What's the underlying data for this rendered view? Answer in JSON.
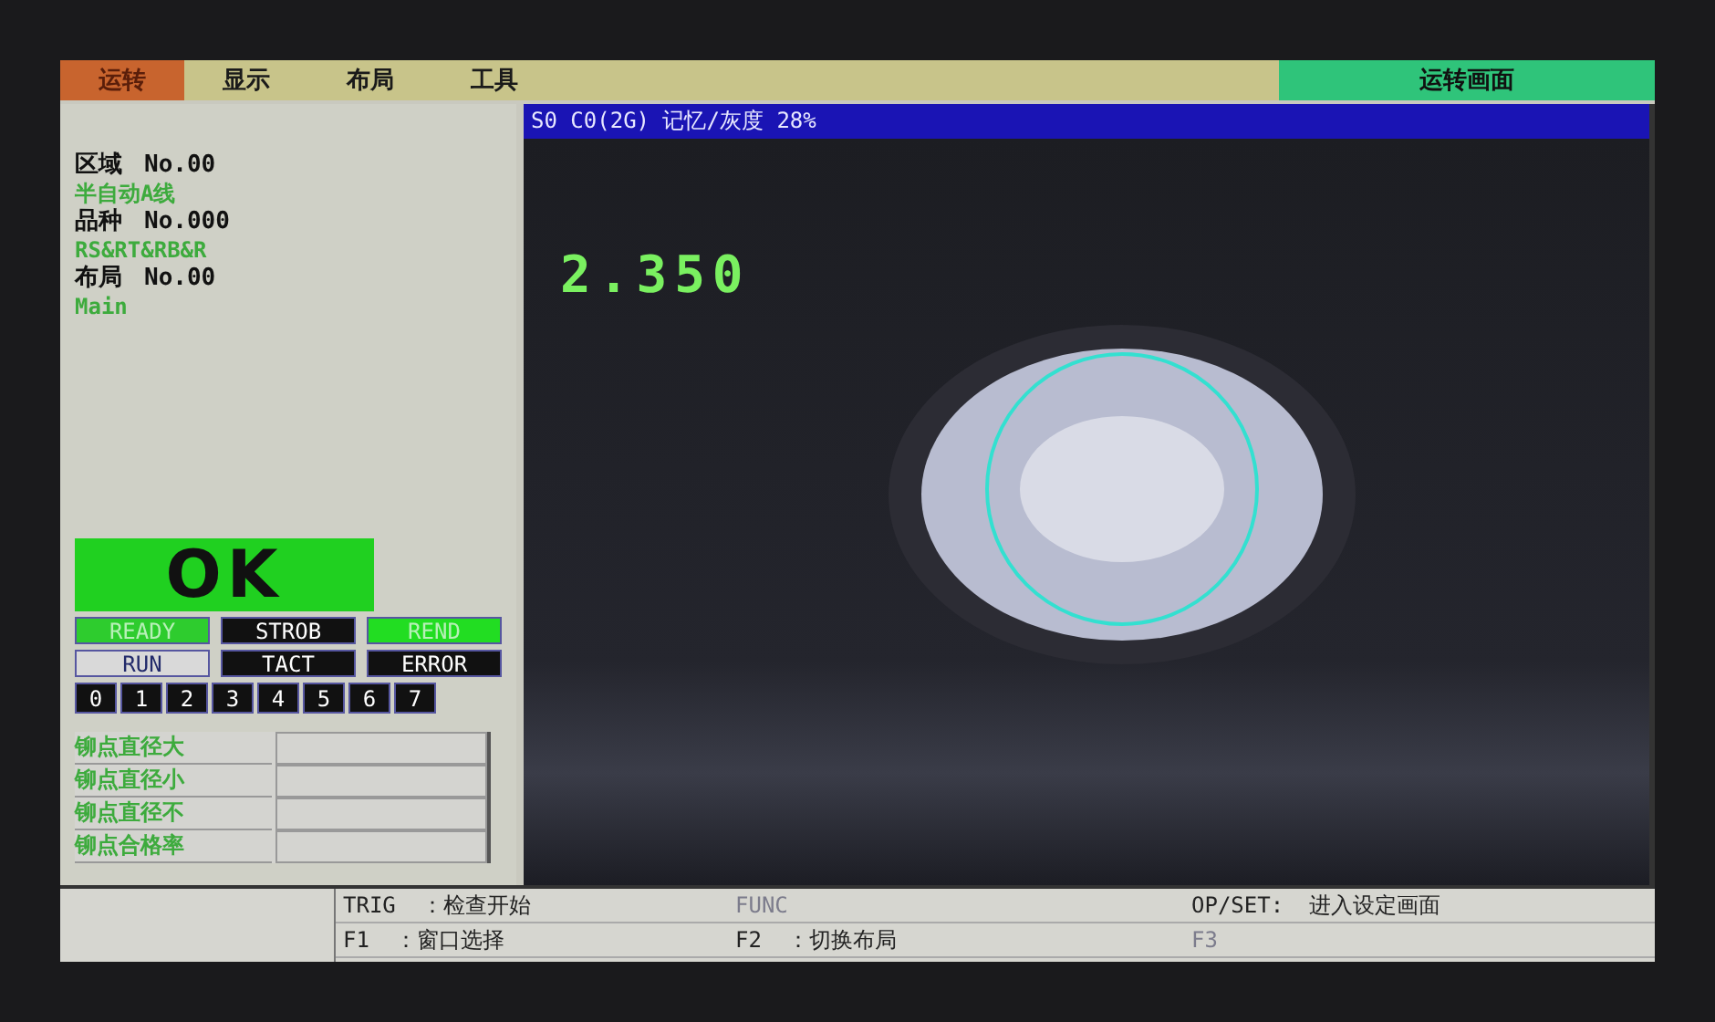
{
  "menu": {
    "tabs": [
      {
        "label": "运转",
        "selected": true
      },
      {
        "label": "显示",
        "selected": false
      },
      {
        "label": "布局",
        "selected": false
      },
      {
        "label": "工具",
        "selected": false
      }
    ],
    "screen_name": "运转画面"
  },
  "info": [
    {
      "kind": "number",
      "label": "区域",
      "value": "No.00"
    },
    {
      "kind": "name",
      "text": "半自动A线"
    },
    {
      "kind": "number",
      "label": "品种",
      "value": "No.000"
    },
    {
      "kind": "name",
      "text": "RS&RT&RB&R"
    },
    {
      "kind": "number",
      "label": "布局",
      "value": "No.00"
    },
    {
      "kind": "name",
      "text": "Main"
    }
  ],
  "result": "OK",
  "signals": [
    {
      "label": "READY",
      "color": "#2ecc2e"
    },
    {
      "label": "STROB",
      "color": "#111111"
    },
    {
      "label": "REND",
      "color": "#22dd22"
    },
    {
      "label": "RUN",
      "color": "#d9d9d9"
    },
    {
      "label": "TACT",
      "color": "#111111"
    },
    {
      "label": "ERROR",
      "color": "#111111"
    }
  ],
  "bits": [
    "0",
    "1",
    "2",
    "3",
    "4",
    "5",
    "6",
    "7"
  ],
  "stats": [
    {
      "label": "铆点直径大"
    },
    {
      "label": "铆点直径小"
    },
    {
      "label": "铆点直径不"
    },
    {
      "label": "铆点合格率"
    }
  ],
  "view": {
    "header": "S0 C0(2G) 记忆/灰度 28%",
    "reading": "2.350"
  },
  "keys": [
    {
      "key": "TRIG",
      "action": "：检查开始",
      "disabled": false
    },
    {
      "key": "FUNC",
      "disabled": true
    },
    {
      "key": "OP/SET:",
      "action": "进入设定画面",
      "disabled": false
    },
    {
      "key": "F1",
      "action": "：窗口选择",
      "disabled": false
    },
    {
      "key": "F2",
      "action": "：切换布局",
      "disabled": false
    },
    {
      "key": "F3",
      "disabled": true
    }
  ]
}
